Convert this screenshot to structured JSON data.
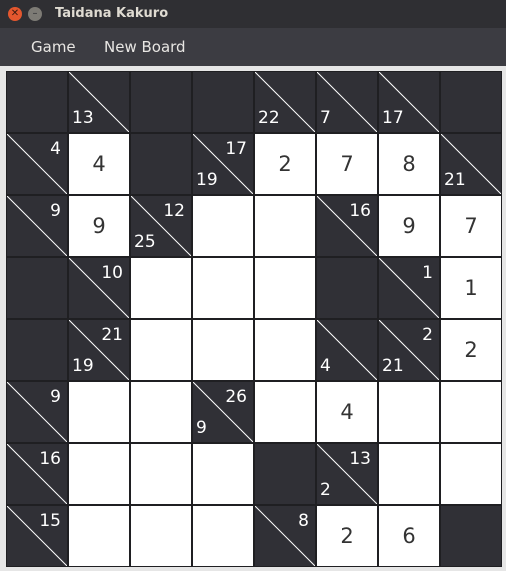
{
  "window": {
    "title": "Taidana Kakuro"
  },
  "menu": {
    "items": [
      "Game",
      "New Board"
    ]
  },
  "board": {
    "rows": 8,
    "cols": 8,
    "cells": [
      [
        {
          "t": "b"
        },
        {
          "t": "c",
          "d": "13"
        },
        {
          "t": "b"
        },
        {
          "t": "b"
        },
        {
          "t": "c",
          "d": "22"
        },
        {
          "t": "c",
          "d": "7"
        },
        {
          "t": "c",
          "d": "17"
        },
        {
          "t": "b"
        }
      ],
      [
        {
          "t": "c",
          "r": "4"
        },
        {
          "t": "w",
          "v": "4"
        },
        {
          "t": "b"
        },
        {
          "t": "c",
          "r": "17",
          "d": "19"
        },
        {
          "t": "w",
          "v": "2"
        },
        {
          "t": "w",
          "v": "7"
        },
        {
          "t": "w",
          "v": "8"
        },
        {
          "t": "c",
          "d": "21"
        }
      ],
      [
        {
          "t": "c",
          "r": "9"
        },
        {
          "t": "w",
          "v": "9"
        },
        {
          "t": "c",
          "r": "12",
          "d": "25"
        },
        {
          "t": "w",
          "v": ""
        },
        {
          "t": "w",
          "v": ""
        },
        {
          "t": "c",
          "r": "16"
        },
        {
          "t": "w",
          "v": "9"
        },
        {
          "t": "w",
          "v": "7"
        }
      ],
      [
        {
          "t": "b"
        },
        {
          "t": "c",
          "r": "10"
        },
        {
          "t": "w",
          "v": ""
        },
        {
          "t": "w",
          "v": ""
        },
        {
          "t": "w",
          "v": ""
        },
        {
          "t": "b"
        },
        {
          "t": "c",
          "r": "1"
        },
        {
          "t": "w",
          "v": "1"
        }
      ],
      [
        {
          "t": "b"
        },
        {
          "t": "c",
          "r": "21",
          "d": "19"
        },
        {
          "t": "w",
          "v": ""
        },
        {
          "t": "w",
          "v": ""
        },
        {
          "t": "w",
          "v": ""
        },
        {
          "t": "c",
          "d": "4"
        },
        {
          "t": "c",
          "r": "2",
          "d": "21"
        },
        {
          "t": "w",
          "v": "2"
        }
      ],
      [
        {
          "t": "c",
          "r": "9"
        },
        {
          "t": "w",
          "v": ""
        },
        {
          "t": "w",
          "v": ""
        },
        {
          "t": "c",
          "r": "26",
          "d": "9"
        },
        {
          "t": "w",
          "v": ""
        },
        {
          "t": "w",
          "v": "4"
        },
        {
          "t": "w",
          "v": ""
        },
        {
          "t": "w",
          "v": ""
        }
      ],
      [
        {
          "t": "c",
          "r": "16"
        },
        {
          "t": "w",
          "v": ""
        },
        {
          "t": "w",
          "v": ""
        },
        {
          "t": "w",
          "v": ""
        },
        {
          "t": "b"
        },
        {
          "t": "c",
          "r": "13",
          "d": "2"
        },
        {
          "t": "w",
          "v": ""
        },
        {
          "t": "w",
          "v": ""
        }
      ],
      [
        {
          "t": "c",
          "r": "15"
        },
        {
          "t": "w",
          "v": ""
        },
        {
          "t": "w",
          "v": ""
        },
        {
          "t": "w",
          "v": ""
        },
        {
          "t": "c",
          "r": "8"
        },
        {
          "t": "w",
          "v": "2"
        },
        {
          "t": "w",
          "v": "6"
        },
        {
          "t": "b"
        }
      ]
    ]
  }
}
